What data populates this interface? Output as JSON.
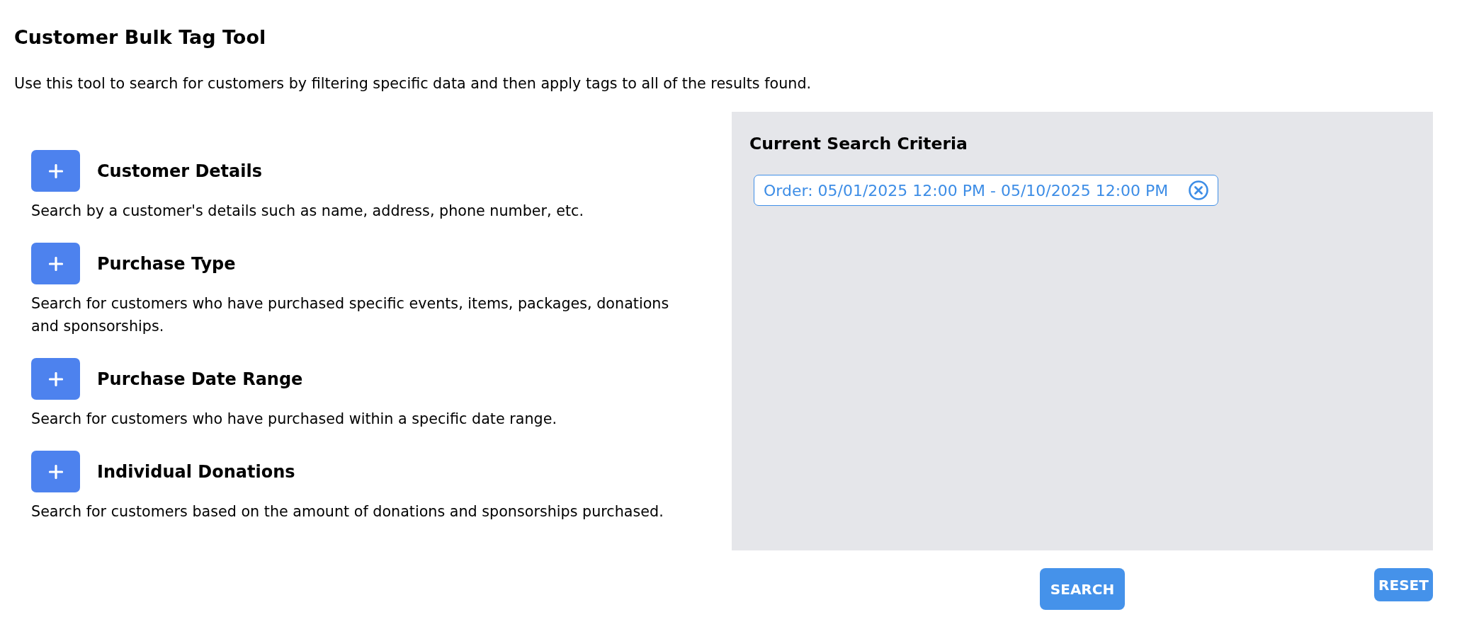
{
  "page": {
    "title": "Customer Bulk Tag Tool",
    "description": "Use this tool to search for customers by filtering specific data and then apply tags to all of the results found."
  },
  "filters": [
    {
      "title": "Customer Details",
      "description": "Search by a customer's details such as name, address, phone number, etc.",
      "expanded": false
    },
    {
      "title": "Purchase Type",
      "description": "Search for customers who have purchased specific events, items, packages, donations and sponsorships.",
      "expanded": false
    },
    {
      "title": "Purchase Date Range",
      "description": "Search for customers who have purchased within a specific date range.",
      "expanded": false
    },
    {
      "title": "Individual Donations",
      "description": "Search for customers based on the amount of donations and sponsorships purchased.",
      "expanded": false
    }
  ],
  "criteria": {
    "title": "Current Search Criteria",
    "chips": [
      {
        "label": "Order: 05/01/2025 12:00 PM - 05/10/2025 12:00 PM"
      }
    ]
  },
  "search_button": {
    "label": "SEARCH"
  },
  "reset_button": {
    "label": "RESET"
  }
}
